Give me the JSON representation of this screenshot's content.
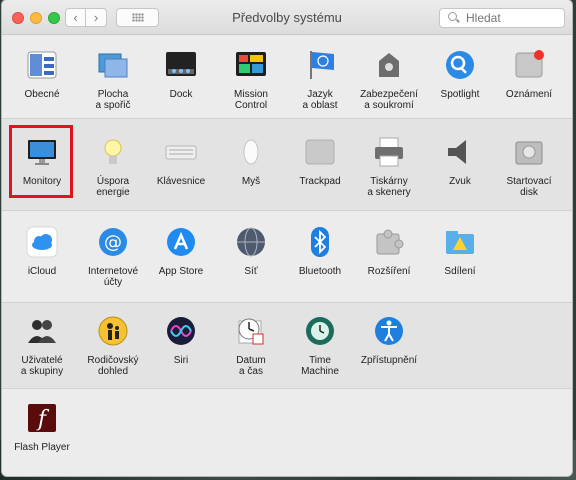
{
  "window": {
    "title": "Předvolby systému"
  },
  "toolbar": {
    "back_label": "‹",
    "forward_label": "›"
  },
  "search": {
    "placeholder": "Hledat"
  },
  "rows": [
    {
      "items": [
        {
          "label": "Obecné",
          "icon": "general-icon"
        },
        {
          "label": "Plocha\na spořič",
          "icon": "desktop-screensaver-icon"
        },
        {
          "label": "Dock",
          "icon": "dock-icon"
        },
        {
          "label": "Mission\nControl",
          "icon": "mission-control-icon"
        },
        {
          "label": "Jazyk\na oblast",
          "icon": "language-region-icon"
        },
        {
          "label": "Zabezpečení\na soukromí",
          "icon": "security-privacy-icon"
        },
        {
          "label": "Spotlight",
          "icon": "spotlight-icon"
        },
        {
          "label": "Oznámení",
          "icon": "notifications-icon"
        }
      ]
    },
    {
      "items": [
        {
          "label": "Monitory",
          "icon": "displays-icon"
        },
        {
          "label": "Úspora\nenergie",
          "icon": "energy-saver-icon"
        },
        {
          "label": "Klávesnice",
          "icon": "keyboard-icon"
        },
        {
          "label": "Myš",
          "icon": "mouse-icon"
        },
        {
          "label": "Trackpad",
          "icon": "trackpad-icon"
        },
        {
          "label": "Tiskárny\na skenery",
          "icon": "printers-icon"
        },
        {
          "label": "Zvuk",
          "icon": "sound-icon"
        },
        {
          "label": "Startovací\ndisk",
          "icon": "startup-disk-icon"
        }
      ]
    },
    {
      "items": [
        {
          "label": "iCloud",
          "icon": "icloud-icon"
        },
        {
          "label": "Internetové\núčty",
          "icon": "internet-accounts-icon"
        },
        {
          "label": "App Store",
          "icon": "app-store-icon"
        },
        {
          "label": "Síť",
          "icon": "network-icon"
        },
        {
          "label": "Bluetooth",
          "icon": "bluetooth-icon"
        },
        {
          "label": "Rozšíření",
          "icon": "extensions-icon"
        },
        {
          "label": "Sdílení",
          "icon": "sharing-icon"
        }
      ]
    },
    {
      "items": [
        {
          "label": "Uživatelé\na skupiny",
          "icon": "users-groups-icon"
        },
        {
          "label": "Rodičovský\ndohled",
          "icon": "parental-controls-icon"
        },
        {
          "label": "Siri",
          "icon": "siri-icon"
        },
        {
          "label": "Datum\na čas",
          "icon": "date-time-icon"
        },
        {
          "label": "Time\nMachine",
          "icon": "time-machine-icon"
        },
        {
          "label": "Zpřístupnění",
          "icon": "accessibility-icon"
        }
      ]
    },
    {
      "items": [
        {
          "label": "Flash Player",
          "icon": "flash-player-icon"
        }
      ]
    }
  ],
  "colors": {
    "highlight": "#e0141e",
    "window_bg": "#ececec"
  }
}
